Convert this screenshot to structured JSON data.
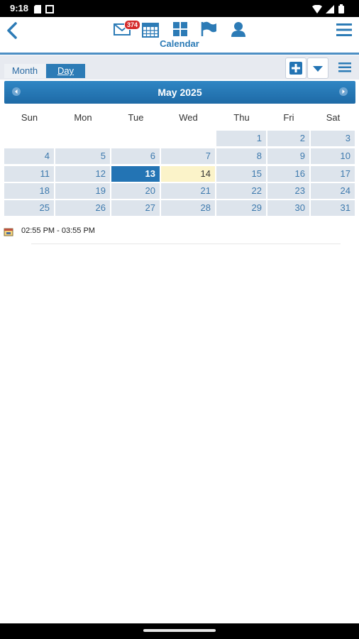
{
  "status_bar": {
    "time": "9:18"
  },
  "header": {
    "title": "Calendar",
    "mail_badge": "374"
  },
  "tabs": [
    {
      "label": "Month"
    },
    {
      "label": "Day"
    }
  ],
  "calendar": {
    "month_title": "May 2025",
    "weekdays": [
      "Sun",
      "Mon",
      "Tue",
      "Wed",
      "Thu",
      "Fri",
      "Sat"
    ],
    "weeks": [
      [
        "",
        "",
        "",
        "",
        "1",
        "2",
        "3"
      ],
      [
        "4",
        "5",
        "6",
        "7",
        "8",
        "9",
        "10"
      ],
      [
        "11",
        "12",
        "13",
        "14",
        "15",
        "16",
        "17"
      ],
      [
        "18",
        "19",
        "20",
        "21",
        "22",
        "23",
        "24"
      ],
      [
        "25",
        "26",
        "27",
        "28",
        "29",
        "30",
        "31"
      ]
    ],
    "selected_day": "13",
    "today": "14"
  },
  "events": [
    {
      "time": "02:55 PM - 03:55 PM"
    }
  ],
  "colors": {
    "accent": "#2c7bb6",
    "selected": "#2374b4",
    "today": "#fbf3c9",
    "cell": "#dde4ec"
  }
}
